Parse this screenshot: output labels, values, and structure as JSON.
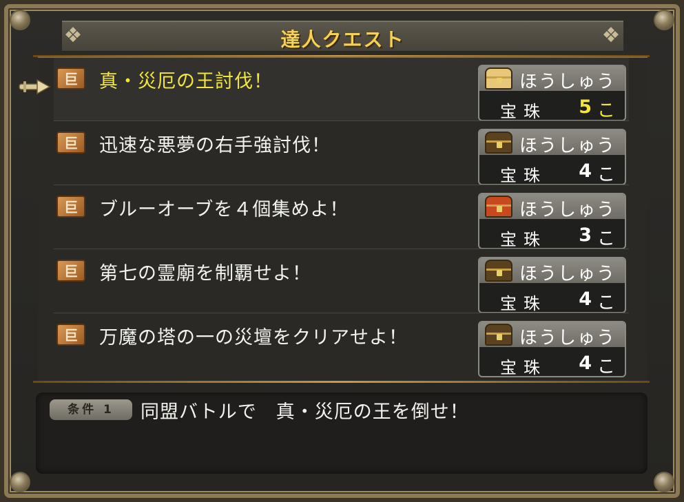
{
  "title": "達人クエスト",
  "deco_glyph": "❖",
  "quests": [
    {
      "name": "真・災厄の王討伐！",
      "selected": true,
      "reward_label": "ほうしゅう",
      "reward_item": "宝珠",
      "reward_count": "5",
      "reward_unit": "こ",
      "chest": "gold-chest",
      "chest_color": "#e8c878"
    },
    {
      "name": "迅速な悪夢の右手強討伐！",
      "selected": false,
      "reward_label": "ほうしゅう",
      "reward_item": "宝珠",
      "reward_count": "4",
      "reward_unit": "こ",
      "chest": "dark-chest",
      "chest_color": "#5a4220"
    },
    {
      "name": "ブルーオーブを４個集めよ！",
      "selected": false,
      "reward_label": "ほうしゅう",
      "reward_item": "宝珠",
      "reward_count": "3",
      "reward_unit": "こ",
      "chest": "red-chest",
      "chest_color": "#c84820"
    },
    {
      "name": "第七の霊廟を制覇せよ！",
      "selected": false,
      "reward_label": "ほうしゅう",
      "reward_item": "宝珠",
      "reward_count": "4",
      "reward_unit": "こ",
      "chest": "dark-chest",
      "chest_color": "#5a4220"
    },
    {
      "name": "万魔の塔の一の災壇をクリアせよ！",
      "selected": false,
      "reward_label": "ほうしゅう",
      "reward_item": "宝珠",
      "reward_count": "4",
      "reward_unit": "こ",
      "chest": "dark-chest",
      "chest_color": "#5a4220"
    }
  ],
  "quest_icon_glyph": "巨",
  "condition": {
    "badge": "条件 1",
    "text": "同盟バトルで　真・災厄の王を倒せ！"
  },
  "colors": {
    "title_gold": "#f3d256",
    "selected_yellow": "#f3e63a",
    "panel_bg": "#2a2926",
    "frame": "#8b7a55"
  }
}
